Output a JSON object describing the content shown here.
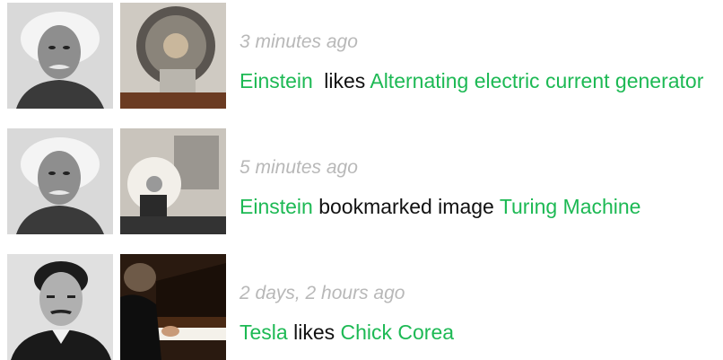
{
  "colors": {
    "link": "#1db954",
    "timestamp": "#b8b8b8",
    "text": "#111111"
  },
  "feed": [
    {
      "actor_image": "einstein-portrait",
      "object_image": "alternating-current-generator-photo",
      "timestamp": "3 minutes ago",
      "actor": "Einstein",
      "verb": "likes",
      "object": "Alternating electric current generator"
    },
    {
      "actor_image": "einstein-portrait",
      "object_image": "turing-machine-photo",
      "timestamp": "5 minutes ago",
      "actor": "Einstein",
      "verb": "bookmarked image",
      "object": "Turing Machine"
    },
    {
      "actor_image": "tesla-portrait",
      "object_image": "chick-corea-piano-photo",
      "timestamp": "2 days, 2 hours ago",
      "actor": "Tesla",
      "verb": "likes",
      "object": "Chick Corea"
    }
  ]
}
